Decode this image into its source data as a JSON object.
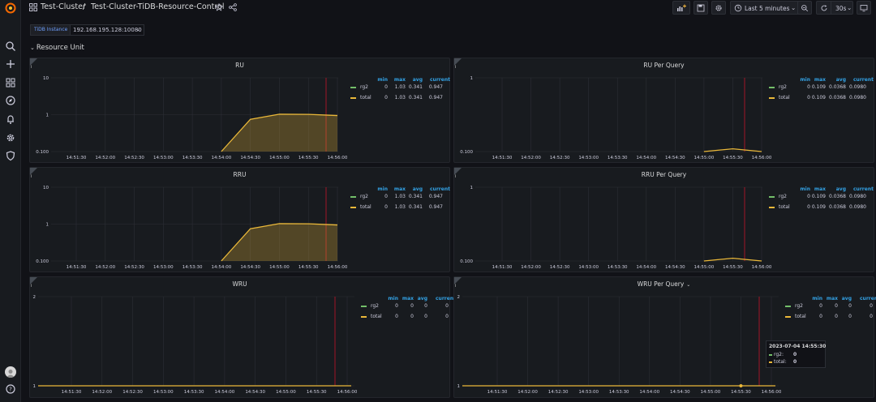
{
  "breadcrumb": {
    "folder": "Test-Cluster",
    "separator": "/",
    "dashboard": "Test-Cluster-TiDB-Resource-Control"
  },
  "toolbar": {
    "time_range": "Last 5 minutes",
    "refresh_interval": "30s"
  },
  "variables": {
    "label": "TiDB Instance",
    "value": "192.168.195.128:10080"
  },
  "row": {
    "title": "Resource Unit"
  },
  "legend_headers": [
    "min",
    "max",
    "avg",
    "current"
  ],
  "colors": {
    "rg2": "#73bf69",
    "total": "#eab839",
    "threshold": "#c4162a",
    "grid": "#2c2f36",
    "axis_text": "#ccccdc"
  },
  "x_ticks": [
    "14:51:30",
    "14:52:00",
    "14:52:30",
    "14:53:00",
    "14:53:30",
    "14:54:00",
    "14:54:30",
    "14:55:00",
    "14:55:30",
    "14:56:00"
  ],
  "panels": [
    {
      "id": "ru",
      "title": "RU",
      "y_ticks": [
        "10",
        "1",
        "0.100"
      ],
      "legend": [
        {
          "name": "rg2",
          "min": "0",
          "max": "1.03",
          "avg": "0.341",
          "current": "0.947"
        },
        {
          "name": "total",
          "min": "0",
          "max": "1.03",
          "avg": "0.341",
          "current": "0.947"
        }
      ],
      "chart_data": {
        "type": "area",
        "scale": "log",
        "ylim": [
          0.1,
          10
        ],
        "x": [
          "14:54:00",
          "14:54:30",
          "14:55:00",
          "14:55:30",
          "14:56:00"
        ],
        "values": [
          0.1,
          0.75,
          1.03,
          1.02,
          0.947
        ]
      }
    },
    {
      "id": "ru-per-query",
      "title": "RU Per Query",
      "y_ticks": [
        "1",
        "0.100"
      ],
      "legend": [
        {
          "name": "rg2",
          "min": "0",
          "max": "0.109",
          "avg": "0.0368",
          "current": "0.0980"
        },
        {
          "name": "total",
          "min": "0",
          "max": "0.109",
          "avg": "0.0368",
          "current": "0.0980"
        }
      ],
      "chart_data": {
        "type": "line",
        "scale": "log",
        "ylim": [
          0.1,
          1
        ],
        "x": [
          "14:55:00",
          "14:55:30",
          "14:56:00"
        ],
        "values": [
          0.1,
          0.109,
          0.098
        ]
      }
    },
    {
      "id": "rru",
      "title": "RRU",
      "y_ticks": [
        "10",
        "1",
        "0.100"
      ],
      "legend": [
        {
          "name": "rg2",
          "min": "0",
          "max": "1.03",
          "avg": "0.341",
          "current": "0.947"
        },
        {
          "name": "total",
          "min": "0",
          "max": "1.03",
          "avg": "0.341",
          "current": "0.947"
        }
      ],
      "chart_data": {
        "type": "area",
        "scale": "log",
        "ylim": [
          0.1,
          10
        ],
        "x": [
          "14:54:00",
          "14:54:30",
          "14:55:00",
          "14:55:30",
          "14:56:00"
        ],
        "values": [
          0.1,
          0.75,
          1.03,
          1.02,
          0.947
        ]
      }
    },
    {
      "id": "rru-per-query",
      "title": "RRU Per Query",
      "y_ticks": [
        "1",
        "0.100"
      ],
      "legend": [
        {
          "name": "rg2",
          "min": "0",
          "max": "0.109",
          "avg": "0.0368",
          "current": "0.0980"
        },
        {
          "name": "total",
          "min": "0",
          "max": "0.109",
          "avg": "0.0368",
          "current": "0.0980"
        }
      ],
      "chart_data": {
        "type": "line",
        "scale": "log",
        "ylim": [
          0.1,
          1
        ],
        "x": [
          "14:55:00",
          "14:55:30",
          "14:56:00"
        ],
        "values": [
          0.1,
          0.109,
          0.098
        ]
      }
    },
    {
      "id": "wru",
      "title": "WRU",
      "y_ticks": [
        "2",
        "1"
      ],
      "legend": [
        {
          "name": "rg2",
          "min": "0",
          "max": "0",
          "avg": "0",
          "current": "0"
        },
        {
          "name": "total",
          "min": "0",
          "max": "0",
          "avg": "0",
          "current": "0"
        }
      ],
      "chart_data": {
        "type": "line",
        "scale": "linear",
        "ylim": [
          1,
          2
        ],
        "values": []
      }
    },
    {
      "id": "wru-per-query",
      "title": "WRU Per Query",
      "title_suffix": "⌄",
      "y_ticks": [
        "2",
        "1"
      ],
      "legend": [
        {
          "name": "rg2",
          "min": "0",
          "max": "0",
          "avg": "0",
          "current": "0"
        },
        {
          "name": "total",
          "min": "0",
          "max": "0",
          "avg": "0",
          "current": "0"
        }
      ],
      "chart_data": {
        "type": "line",
        "scale": "linear",
        "ylim": [
          1,
          2
        ],
        "values": []
      }
    }
  ],
  "tooltip": {
    "time": "2023-07-04 14:55:30",
    "rows": [
      {
        "name": "rg2:",
        "value": "0"
      },
      {
        "name": "total:",
        "value": "0"
      }
    ]
  }
}
